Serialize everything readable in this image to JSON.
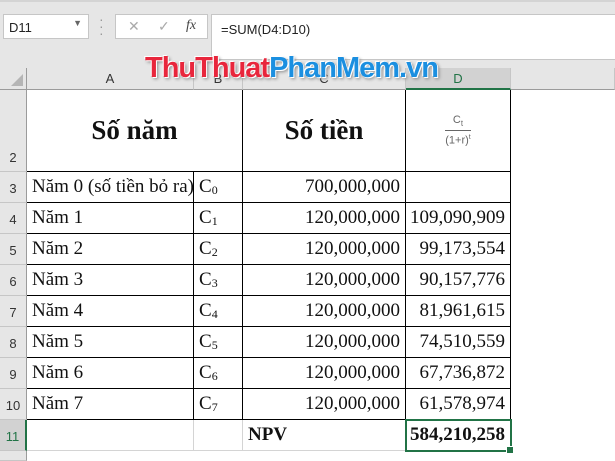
{
  "formula_bar": {
    "name_box": "D11",
    "cancel_icon": "✕",
    "enter_icon": "✓",
    "fx_label": "fx",
    "formula": "=SUM(D4:D10)"
  },
  "logo": {
    "part1": "ThuThuat",
    "part2": "PhanMem.vn"
  },
  "columns": [
    "A",
    "B",
    "C",
    "D"
  ],
  "rows": [
    "2",
    "3",
    "4",
    "5",
    "6",
    "7",
    "8",
    "9",
    "10",
    "11"
  ],
  "header": {
    "years": "Số năm",
    "amount": "Số tiền",
    "formula_num": "Ct",
    "formula_num_base": "C",
    "formula_num_sub": "t",
    "formula_den": "(1+r)",
    "formula_den_sup": "t"
  },
  "data": [
    {
      "year": "Năm 0 (số tiền bỏ ra)",
      "c": "C",
      "sub": "0",
      "amount": "700,000,000",
      "pv": ""
    },
    {
      "year": "Năm 1",
      "c": "C",
      "sub": "1",
      "amount": "120,000,000",
      "pv": "109,090,909"
    },
    {
      "year": "Năm 2",
      "c": "C",
      "sub": "2",
      "amount": "120,000,000",
      "pv": "99,173,554"
    },
    {
      "year": "Năm 3",
      "c": "C",
      "sub": "3",
      "amount": "120,000,000",
      "pv": "90,157,776"
    },
    {
      "year": "Năm 4",
      "c": "C",
      "sub": "4",
      "amount": "120,000,000",
      "pv": "81,961,615"
    },
    {
      "year": "Năm 5",
      "c": "C",
      "sub": "5",
      "amount": "120,000,000",
      "pv": "74,510,559"
    },
    {
      "year": "Năm 6",
      "c": "C",
      "sub": "6",
      "amount": "120,000,000",
      "pv": "67,736,872"
    },
    {
      "year": "Năm 7",
      "c": "C",
      "sub": "7",
      "amount": "120,000,000",
      "pv": "61,578,974"
    }
  ],
  "total": {
    "label": "NPV",
    "value": "584,210,258"
  }
}
